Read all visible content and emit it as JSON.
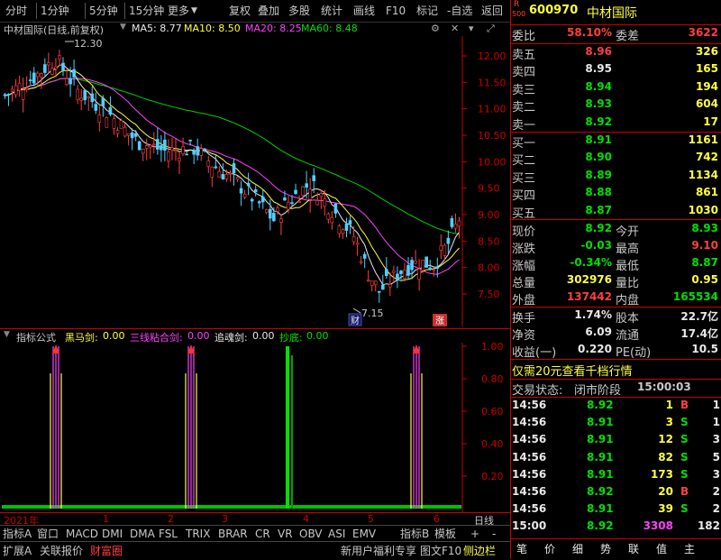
{
  "toolbar": {
    "items": [
      "分时",
      "1分钟",
      "5分钟",
      "15分钟",
      "更多",
      "复权",
      "叠加",
      "多股",
      "统计",
      "画线",
      "F10",
      "标记",
      "-自选",
      "返回"
    ]
  },
  "chart_header": {
    "title": "中材国际(日线,前复权)",
    "ma5": "MA5: 8.77",
    "ma10": "MA10: 8.50",
    "ma20": "MA20: 8.25",
    "ma60": "MA60: 8.48",
    "high_mark": "12.30",
    "low_mark": "7.15",
    "cai_badge": "财",
    "zhang_badge": "涨"
  },
  "price_axis": [
    "12.00",
    "11.50",
    "11.00",
    "10.50",
    "10.00",
    "9.50",
    "9.00",
    "8.50",
    "8.00",
    "7.50"
  ],
  "indicator_header": {
    "name": "指标公式",
    "items": [
      {
        "label": "黑马剑:",
        "value": "0.00",
        "color": "#ffff40"
      },
      {
        "label": "三线粘合剑:",
        "value": "0.00",
        "color": "#ff40ff"
      },
      {
        "label": "追魂剑:",
        "value": "0.00",
        "color": "#e8e8e8"
      },
      {
        "label": "抄底:",
        "value": "0.00",
        "color": "#00e000"
      }
    ]
  },
  "indicator_axis": [
    "1.00",
    "0.80",
    "0.60",
    "0.40",
    "0.20"
  ],
  "time_axis": {
    "year": "2021年",
    "months": [
      "1",
      "2",
      "3",
      "4",
      "5",
      "6"
    ],
    "right_label": "日线"
  },
  "tabs_row1": [
    "指标A",
    "窗口",
    "MACD",
    "DMI",
    "DMA",
    "FSL",
    "TRIX",
    "BRAR",
    "CR",
    "VR",
    "OBV",
    "ASI",
    "EMV",
    "指标B",
    "模板",
    "+",
    "-"
  ],
  "tabs_row2": {
    "left": [
      "扩展A",
      "关联报价",
      "财富圈"
    ],
    "right": [
      "新用户福利专享",
      "图文F10",
      "侧边栏"
    ]
  },
  "quote": {
    "r_label": "R",
    "r_num": "500",
    "code": "600970",
    "name": "中材国际",
    "weibi_label": "委比",
    "weibi": "58.10%",
    "weicha_label": "委差",
    "weicha": "3622",
    "asks": [
      {
        "label": "卖五",
        "price": "8.96",
        "vol": "326",
        "pc": "red"
      },
      {
        "label": "卖四",
        "price": "8.95",
        "vol": "165",
        "pc": "wht"
      },
      {
        "label": "卖三",
        "price": "8.94",
        "vol": "194",
        "pc": "grn"
      },
      {
        "label": "卖二",
        "price": "8.93",
        "vol": "604",
        "pc": "grn"
      },
      {
        "label": "卖一",
        "price": "8.92",
        "vol": "17",
        "pc": "grn"
      }
    ],
    "bids": [
      {
        "label": "买一",
        "price": "8.91",
        "vol": "1161",
        "pc": "grn"
      },
      {
        "label": "买二",
        "price": "8.90",
        "vol": "742",
        "pc": "grn"
      },
      {
        "label": "买三",
        "price": "8.89",
        "vol": "1134",
        "pc": "grn"
      },
      {
        "label": "买四",
        "price": "8.88",
        "vol": "861",
        "pc": "grn"
      },
      {
        "label": "买五",
        "price": "8.87",
        "vol": "1030",
        "pc": "grn"
      }
    ],
    "stats": [
      {
        "l1": "现价",
        "v1": "8.92",
        "c1": "grn",
        "l2": "今开",
        "v2": "8.93",
        "c2": "grn"
      },
      {
        "l1": "涨跌",
        "v1": "-0.03",
        "c1": "grn",
        "l2": "最高",
        "v2": "9.10",
        "c2": "red"
      },
      {
        "l1": "涨幅",
        "v1": "-0.34%",
        "c1": "grn",
        "l2": "最低",
        "v2": "8.87",
        "c2": "grn"
      },
      {
        "l1": "总量",
        "v1": "302976",
        "c1": "yel",
        "l2": "量比",
        "v2": "0.95",
        "c2": "yel"
      },
      {
        "l1": "外盘",
        "v1": "137442",
        "c1": "red",
        "l2": "内盘",
        "v2": "165534",
        "c2": "grn"
      }
    ],
    "stats2": [
      {
        "l1": "换手",
        "v1": "1.74%",
        "l2": "股本",
        "v2": "22.7亿"
      },
      {
        "l1": "净资",
        "v1": "6.09",
        "l2": "流通",
        "v2": "17.4亿"
      },
      {
        "l1": "收益(一)",
        "v1": "0.220",
        "l2": "PE(动)",
        "v2": "10.5"
      }
    ],
    "promo": "仅需20元查看千档行情",
    "status_label": "交易状态:",
    "status_value": "闭市阶段",
    "status_time": "15:00:03",
    "ticks": [
      {
        "t": "14:56",
        "p": "8.92",
        "pc": "grn",
        "v": "1",
        "vc": "yel",
        "d": "B",
        "dc": "red",
        "n": "1"
      },
      {
        "t": "14:56",
        "p": "8.91",
        "pc": "grn",
        "v": "3",
        "vc": "yel",
        "d": "S",
        "dc": "grn",
        "n": "1"
      },
      {
        "t": "14:56",
        "p": "8.91",
        "pc": "grn",
        "v": "12",
        "vc": "yel",
        "d": "S",
        "dc": "grn",
        "n": "3"
      },
      {
        "t": "14:56",
        "p": "8.91",
        "pc": "grn",
        "v": "82",
        "vc": "yel",
        "d": "S",
        "dc": "grn",
        "n": "5"
      },
      {
        "t": "14:56",
        "p": "8.91",
        "pc": "grn",
        "v": "173",
        "vc": "yel",
        "d": "S",
        "dc": "grn",
        "n": "3"
      },
      {
        "t": "14:56",
        "p": "8.92",
        "pc": "grn",
        "v": "20",
        "vc": "yel",
        "d": "B",
        "dc": "red",
        "n": "2"
      },
      {
        "t": "14:56",
        "p": "8.91",
        "pc": "grn",
        "v": "39",
        "vc": "yel",
        "d": "S",
        "dc": "grn",
        "n": "2"
      },
      {
        "t": "15:00",
        "p": "8.92",
        "pc": "grn",
        "v": "3308",
        "vc": "mag",
        "d": "",
        "dc": "grn",
        "n": "182"
      }
    ],
    "bottom_tabs": [
      "笔",
      "价",
      "细",
      "势",
      "联",
      "值",
      "主"
    ]
  }
}
